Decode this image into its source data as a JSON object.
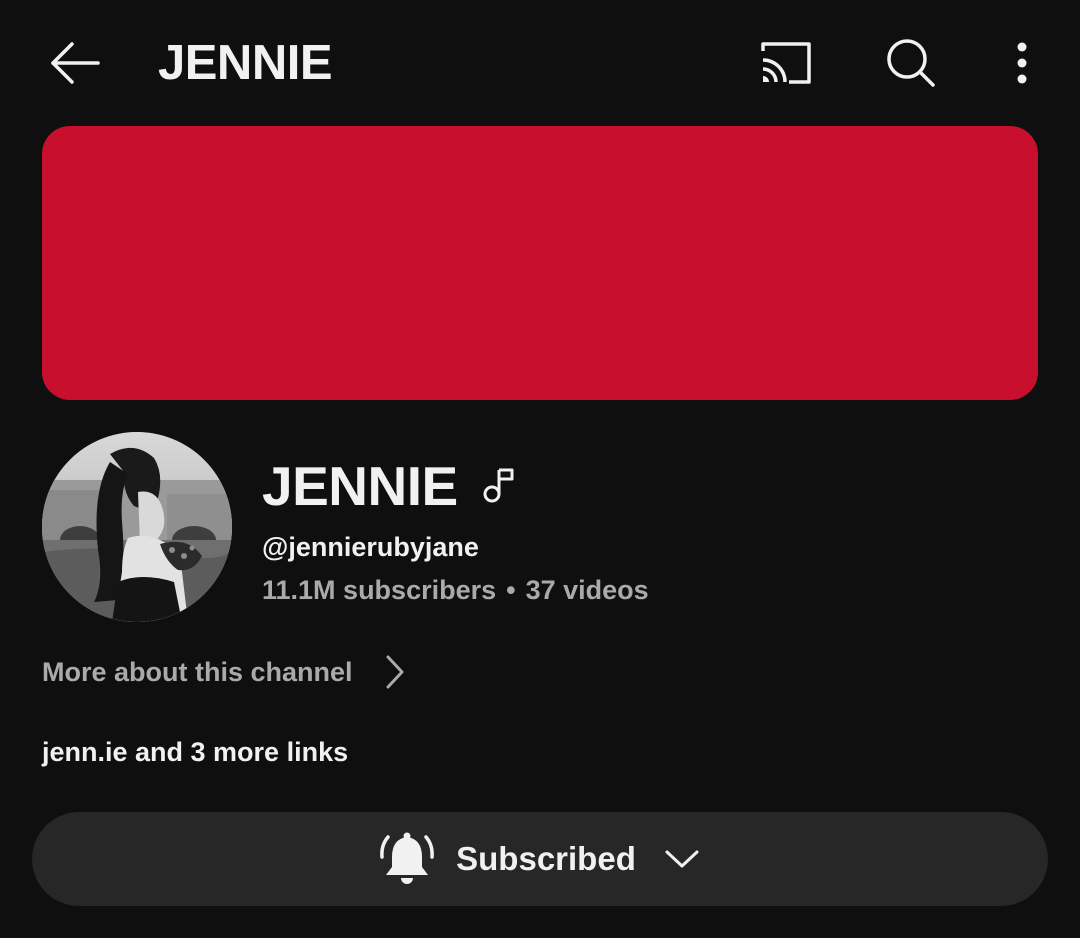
{
  "top_bar": {
    "title": "JENNIE",
    "back_icon": "arrow-left-icon",
    "cast_icon": "cast-icon",
    "search_icon": "search-icon",
    "more_icon": "more-vertical-icon"
  },
  "banner": {
    "color": "#c8102e"
  },
  "channel": {
    "name": "JENNIE",
    "badge_icon": "music-note-icon",
    "handle": "@jennierubyjane",
    "subscribers": "11.1M subscribers",
    "separator": "•",
    "videos": "37 videos",
    "more_about": "More about this channel",
    "links": "jenn.ie and 3 more links"
  },
  "subscribe": {
    "label": "Subscribed",
    "bell_icon": "bell-ringing-icon",
    "chevron_icon": "chevron-down-icon"
  }
}
